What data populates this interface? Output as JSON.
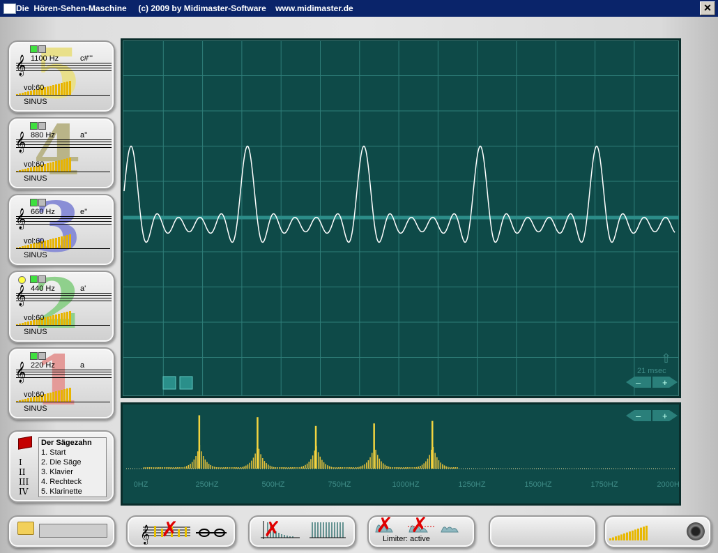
{
  "window": {
    "title": "Die  Hören-Sehen-Maschine     (c) 2009 by Midimaster-Software    www.midimaster.de",
    "close_label": "✕"
  },
  "voices": [
    {
      "number": "5",
      "freq": "1100 Hz",
      "note": "c#'''",
      "vol": "vol:60",
      "volume_level": 60,
      "wave": "SINUS",
      "color": "#e9e08a",
      "active_dot": false
    },
    {
      "number": "4",
      "freq": "880 Hz",
      "note": "a''",
      "vol": "vol:60",
      "volume_level": 60,
      "wave": "SINUS",
      "color": "#b9b488",
      "active_dot": false
    },
    {
      "number": "3",
      "freq": "660 Hz",
      "note": "e''",
      "vol": "vol:60",
      "volume_level": 60,
      "wave": "SINUS",
      "color": "#8a8ed6",
      "active_dot": false
    },
    {
      "number": "2",
      "freq": "440 Hz",
      "note": "a'",
      "vol": "vol:60",
      "volume_level": 60,
      "wave": "SINUS",
      "color": "#8fd08c",
      "active_dot": true
    },
    {
      "number": "1",
      "freq": "220 Hz",
      "note": "a",
      "vol": "vol:60",
      "volume_level": 60,
      "wave": "SINUS",
      "color": "#e49a98",
      "active_dot": false
    }
  ],
  "scope": {
    "time_label": "21 msec",
    "minus_label": "–",
    "plus_label": "+"
  },
  "spectrum": {
    "ticks": [
      "0HZ",
      "250HZ",
      "500HZ",
      "750HZ",
      "1000HZ",
      "1250HZ",
      "1500HZ",
      "1750HZ",
      "2000HZ"
    ],
    "minus_label": "–",
    "plus_label": "+"
  },
  "songs": {
    "header": "Der Sägezahn",
    "items": [
      "1. Start",
      "2. Die Säge",
      "3. Klavier",
      "4. Rechteck",
      "5. Klarinette"
    ],
    "roman": [
      "I",
      "II",
      "III",
      "IV"
    ]
  },
  "bottom": {
    "limiter_label": "Limiter: active",
    "red_x": "✗"
  },
  "chart_data": {
    "type": "bar",
    "title": "",
    "xlabel": "",
    "ylabel": "",
    "x_ticks": [
      "0HZ",
      "250HZ",
      "500HZ",
      "750HZ",
      "1000HZ",
      "1250HZ",
      "1500HZ",
      "1750HZ",
      "2000HZ"
    ],
    "xlim": [
      0,
      2000
    ],
    "peaks_hz": [
      220,
      440,
      660,
      880,
      1100
    ],
    "peak_relative_heights": [
      0.85,
      0.82,
      0.68,
      0.72,
      0.76
    ]
  }
}
